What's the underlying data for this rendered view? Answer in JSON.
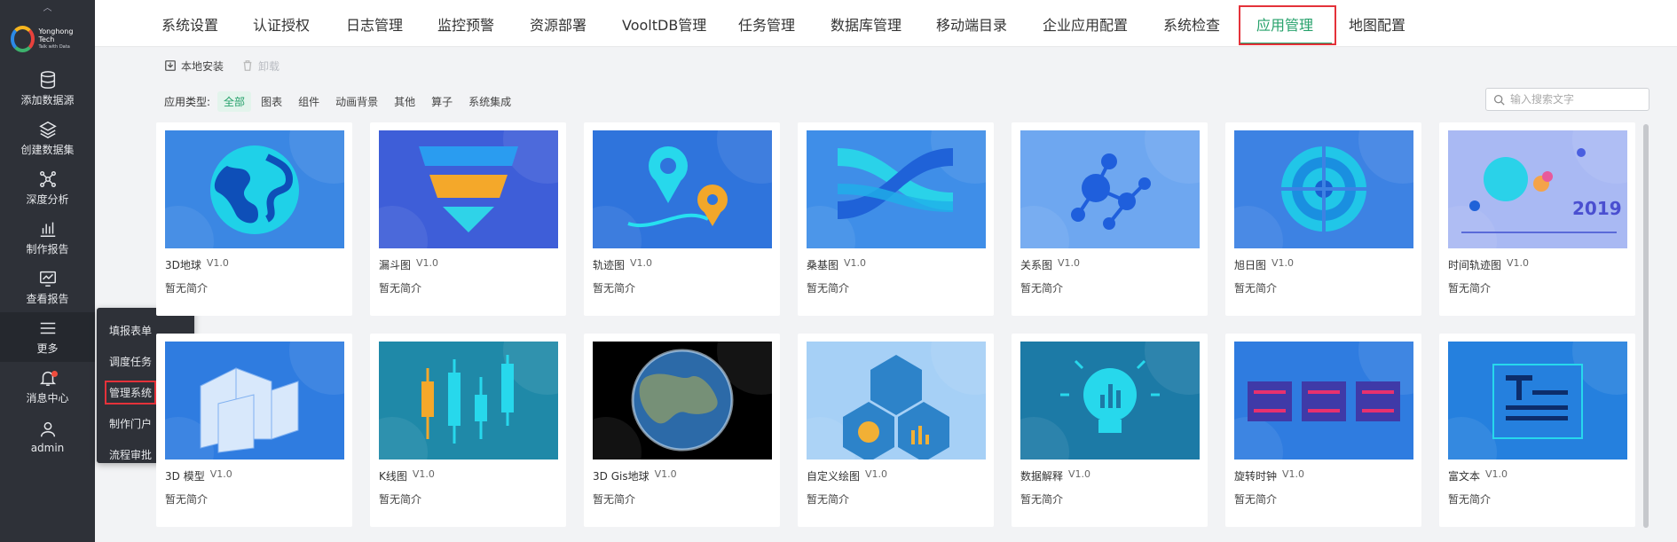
{
  "sidebar": {
    "logo": {
      "name": "Yonghong Tech",
      "tagline": "Talk with Data"
    },
    "items": [
      {
        "label": "添加数据源",
        "icon": "database-icon"
      },
      {
        "label": "创建数据集",
        "icon": "layers-icon"
      },
      {
        "label": "深度分析",
        "icon": "network-icon"
      },
      {
        "label": "制作报告",
        "icon": "bar-chart-icon"
      },
      {
        "label": "查看报告",
        "icon": "monitor-chart-icon"
      },
      {
        "label": "更多",
        "icon": "menu-icon"
      },
      {
        "label": "消息中心",
        "icon": "bell-icon"
      },
      {
        "label": "admin",
        "icon": "user-icon"
      }
    ]
  },
  "popup_menu": {
    "items": [
      "填报表单",
      "调度任务",
      "管理系统",
      "制作门户",
      "流程审批"
    ],
    "highlighted": "管理系统"
  },
  "topnav": {
    "tabs": [
      "系统设置",
      "认证授权",
      "日志管理",
      "监控预警",
      "资源部署",
      "VooltDB管理",
      "任务管理",
      "数据库管理",
      "移动端目录",
      "企业应用配置",
      "系统检查",
      "应用管理",
      "地图配置"
    ],
    "active": "应用管理"
  },
  "toolbar": {
    "install_label": "本地安装",
    "uninstall_label": "卸载"
  },
  "filter": {
    "label": "应用类型:",
    "options": [
      "全部",
      "图表",
      "组件",
      "动画背景",
      "其他",
      "算子",
      "系统集成"
    ],
    "active": "全部"
  },
  "search": {
    "placeholder": "输入搜索文字",
    "value": ""
  },
  "apps": [
    {
      "name": "3D地球",
      "version": "V1.0",
      "desc": "暂无简介",
      "thumb": "globe",
      "bg": "#3b87e3"
    },
    {
      "name": "漏斗图",
      "version": "V1.0",
      "desc": "暂无简介",
      "thumb": "funnel",
      "bg": "#3e5ed8"
    },
    {
      "name": "轨迹图",
      "version": "V1.0",
      "desc": "暂无简介",
      "thumb": "track",
      "bg": "#2f74dc"
    },
    {
      "name": "桑基图",
      "version": "V1.0",
      "desc": "暂无简介",
      "thumb": "sankey",
      "bg": "#3f8ee8"
    },
    {
      "name": "关系图",
      "version": "V1.0",
      "desc": "暂无简介",
      "thumb": "relation",
      "bg": "#6ea7f0"
    },
    {
      "name": "旭日图",
      "version": "V1.0",
      "desc": "暂无简介",
      "thumb": "sunburst",
      "bg": "#3d82e3"
    },
    {
      "name": "时间轨迹图",
      "version": "V1.0",
      "desc": "暂无简介",
      "thumb": "timeline",
      "bg": "#a9b9f3",
      "year": "2019"
    },
    {
      "name": "3D 模型",
      "version": "V1.0",
      "desc": "暂无简介",
      "thumb": "building",
      "bg": "#2f7ce0"
    },
    {
      "name": "K线图",
      "version": "V1.0",
      "desc": "暂无简介",
      "thumb": "kline",
      "bg": "#1f89a8"
    },
    {
      "name": "3D Gis地球",
      "version": "V1.0",
      "desc": "暂无简介",
      "thumb": "earth",
      "bg": "#000000"
    },
    {
      "name": "自定义绘图",
      "version": "V1.0",
      "desc": "暂无简介",
      "thumb": "hexagon",
      "bg": "#a6d0f6"
    },
    {
      "name": "数据解释",
      "version": "V1.0",
      "desc": "暂无简介",
      "thumb": "bulb",
      "bg": "#1c7aa6"
    },
    {
      "name": "旋转时钟",
      "version": "V1.0",
      "desc": "暂无简介",
      "thumb": "clock",
      "bg": "#2f7ce0"
    },
    {
      "name": "富文本",
      "version": "V1.0",
      "desc": "暂无简介",
      "thumb": "richtext",
      "bg": "#2580de"
    }
  ]
}
